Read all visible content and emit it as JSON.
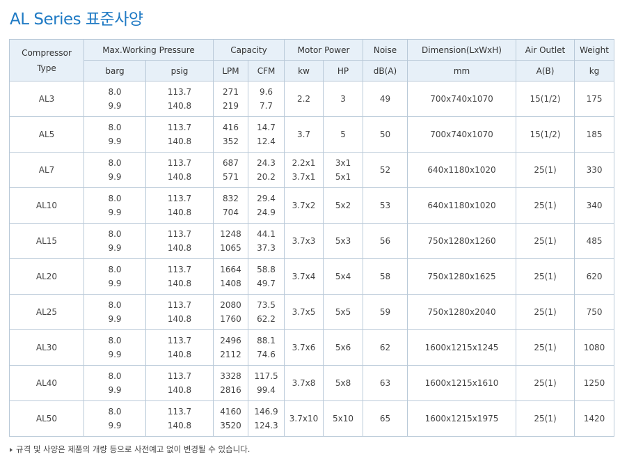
{
  "page": {
    "title": "AL Series 표준사양"
  },
  "table": {
    "headers": {
      "type": "Compressor\nType",
      "pressure": "Max.Working Pressure",
      "capacity": "Capacity",
      "motor": "Motor Power",
      "noise": "Noise",
      "dimension": "Dimension(LxWxH)",
      "outlet": "Air Outlet",
      "weight": "Weight"
    },
    "units": {
      "barg": "barg",
      "psig": "psig",
      "lpm": "LPM",
      "cfm": "CFM",
      "kw": "kw",
      "hp": "HP",
      "db": "dB(A)",
      "mm": "mm",
      "ab": "A(B)",
      "kg": "kg"
    },
    "rows": [
      {
        "type": "AL3",
        "barg": [
          "8.0",
          "9.9"
        ],
        "psig": [
          "113.7",
          "140.8"
        ],
        "lpm": [
          "271",
          "219"
        ],
        "cfm": [
          "9.6",
          "7.7"
        ],
        "kw": [
          "2.2"
        ],
        "hp": [
          "3"
        ],
        "db": "49",
        "dim": "700x740x1070",
        "outlet": "15(1/2)",
        "weight": "175"
      },
      {
        "type": "AL5",
        "barg": [
          "8.0",
          "9.9"
        ],
        "psig": [
          "113.7",
          "140.8"
        ],
        "lpm": [
          "416",
          "352"
        ],
        "cfm": [
          "14.7",
          "12.4"
        ],
        "kw": [
          "3.7"
        ],
        "hp": [
          "5"
        ],
        "db": "50",
        "dim": "700x740x1070",
        "outlet": "15(1/2)",
        "weight": "185"
      },
      {
        "type": "AL7",
        "barg": [
          "8.0",
          "9.9"
        ],
        "psig": [
          "113.7",
          "140.8"
        ],
        "lpm": [
          "687",
          "571"
        ],
        "cfm": [
          "24.3",
          "20.2"
        ],
        "kw": [
          "2.2x1",
          "3.7x1"
        ],
        "hp": [
          "3x1",
          "5x1"
        ],
        "db": "52",
        "dim": "640x1180x1020",
        "outlet": "25(1)",
        "weight": "330"
      },
      {
        "type": "AL10",
        "barg": [
          "8.0",
          "9.9"
        ],
        "psig": [
          "113.7",
          "140.8"
        ],
        "lpm": [
          "832",
          "704"
        ],
        "cfm": [
          "29.4",
          "24.9"
        ],
        "kw": [
          "3.7x2"
        ],
        "hp": [
          "5x2"
        ],
        "db": "53",
        "dim": "640x1180x1020",
        "outlet": "25(1)",
        "weight": "340"
      },
      {
        "type": "AL15",
        "barg": [
          "8.0",
          "9.9"
        ],
        "psig": [
          "113.7",
          "140.8"
        ],
        "lpm": [
          "1248",
          "1065"
        ],
        "cfm": [
          "44.1",
          "37.3"
        ],
        "kw": [
          "3.7x3"
        ],
        "hp": [
          "5x3"
        ],
        "db": "56",
        "dim": "750x1280x1260",
        "outlet": "25(1)",
        "weight": "485"
      },
      {
        "type": "AL20",
        "barg": [
          "8.0",
          "9.9"
        ],
        "psig": [
          "113.7",
          "140.8"
        ],
        "lpm": [
          "1664",
          "1408"
        ],
        "cfm": [
          "58.8",
          "49.7"
        ],
        "kw": [
          "3.7x4"
        ],
        "hp": [
          "5x4"
        ],
        "db": "58",
        "dim": "750x1280x1625",
        "outlet": "25(1)",
        "weight": "620"
      },
      {
        "type": "AL25",
        "barg": [
          "8.0",
          "9.9"
        ],
        "psig": [
          "113.7",
          "140.8"
        ],
        "lpm": [
          "2080",
          "1760"
        ],
        "cfm": [
          "73.5",
          "62.2"
        ],
        "kw": [
          "3.7x5"
        ],
        "hp": [
          "5x5"
        ],
        "db": "59",
        "dim": "750x1280x2040",
        "outlet": "25(1)",
        "weight": "750"
      },
      {
        "type": "AL30",
        "barg": [
          "8.0",
          "9.9"
        ],
        "psig": [
          "113.7",
          "140.8"
        ],
        "lpm": [
          "2496",
          "2112"
        ],
        "cfm": [
          "88.1",
          "74.6"
        ],
        "kw": [
          "3.7x6"
        ],
        "hp": [
          "5x6"
        ],
        "db": "62",
        "dim": "1600x1215x1245",
        "outlet": "25(1)",
        "weight": "1080"
      },
      {
        "type": "AL40",
        "barg": [
          "8.0",
          "9.9"
        ],
        "psig": [
          "113.7",
          "140.8"
        ],
        "lpm": [
          "3328",
          "2816"
        ],
        "cfm": [
          "117.5",
          "99.4"
        ],
        "kw": [
          "3.7x8"
        ],
        "hp": [
          "5x8"
        ],
        "db": "63",
        "dim": "1600x1215x1610",
        "outlet": "25(1)",
        "weight": "1250"
      },
      {
        "type": "AL50",
        "barg": [
          "8.0",
          "9.9"
        ],
        "psig": [
          "113.7",
          "140.8"
        ],
        "lpm": [
          "4160",
          "3520"
        ],
        "cfm": [
          "146.9",
          "124.3"
        ],
        "kw": [
          "3.7x10"
        ],
        "hp": [
          "5x10"
        ],
        "db": "65",
        "dim": "1600x1215x1975",
        "outlet": "25(1)",
        "weight": "1420"
      }
    ]
  },
  "note": "규격 및 사양은 제품의 개량 등으로 사전예고 없이 변경될 수 있습니다."
}
